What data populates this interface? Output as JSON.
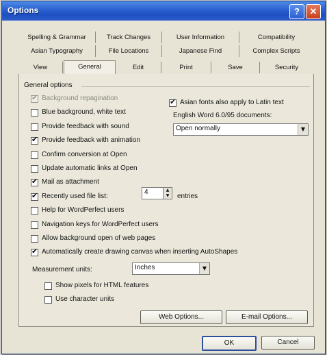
{
  "window": {
    "title": "Options",
    "help_label": "?",
    "close_label": "✕"
  },
  "tabs": {
    "row1": [
      "Spelling & Grammar",
      "Track Changes",
      "User Information",
      "Compatibility"
    ],
    "row2": [
      "Asian Typography",
      "File Locations",
      "Japanese Find",
      "Complex Scripts"
    ],
    "row3": [
      "View",
      "General",
      "Edit",
      "Print",
      "Save",
      "Security"
    ],
    "active": "General"
  },
  "group_title": "General options",
  "options": [
    {
      "label": "Background repagination",
      "checked": true,
      "disabled": true
    },
    {
      "label": "Blue background, white text",
      "checked": false
    },
    {
      "label": "Provide feedback with sound",
      "checked": false
    },
    {
      "label": "Provide feedback with animation",
      "checked": true
    },
    {
      "label": "Confirm conversion at Open",
      "checked": false
    },
    {
      "label": "Update automatic links at Open",
      "checked": false
    },
    {
      "label": "Mail as attachment",
      "checked": true
    },
    {
      "label": "Recently used file list:",
      "checked": true
    },
    {
      "label": "Help for WordPerfect users",
      "checked": false
    },
    {
      "label": "Navigation keys for WordPerfect users",
      "checked": false
    },
    {
      "label": "Allow background open of web pages",
      "checked": false
    },
    {
      "label": "Automatically create drawing canvas when inserting AutoShapes",
      "checked": true
    }
  ],
  "recent_files": {
    "value": "4",
    "suffix": "entries"
  },
  "asian_fonts": {
    "label": "Asian fonts also apply to Latin text",
    "checked": true
  },
  "word6": {
    "label": "English Word 6.0/95 documents:",
    "value": "Open normally"
  },
  "measurement": {
    "label": "Measurement units:",
    "value": "Inches"
  },
  "sub_options": [
    {
      "label": "Show pixels for HTML features",
      "checked": false
    },
    {
      "label": "Use character units",
      "checked": false
    }
  ],
  "buttons": {
    "web_options": "Web Options...",
    "email_options": "E-mail Options...",
    "ok": "OK",
    "cancel": "Cancel"
  },
  "check_glyph": "✔",
  "arrow_glyph": "▼",
  "spin_glyphs": [
    "▲",
    "▼"
  ]
}
